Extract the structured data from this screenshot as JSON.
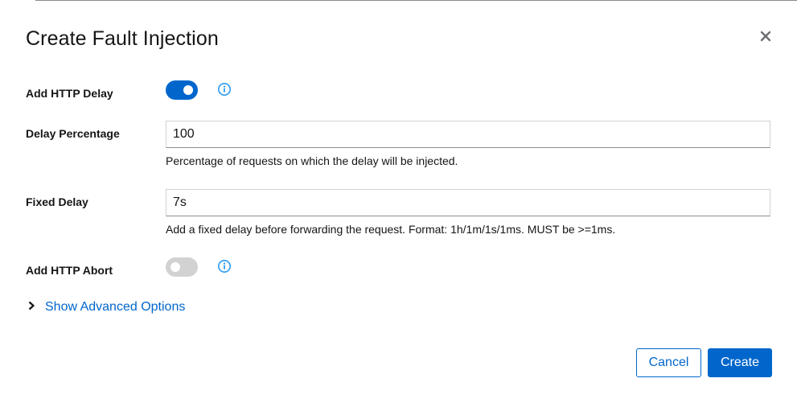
{
  "dialog": {
    "title": "Create Fault Injection",
    "close_icon": "close-icon"
  },
  "fields": {
    "http_delay": {
      "label": "Add HTTP Delay",
      "enabled": true,
      "info_icon": "info-icon"
    },
    "delay_percentage": {
      "label": "Delay Percentage",
      "value": "100",
      "help": "Percentage of requests on which the delay will be injected."
    },
    "fixed_delay": {
      "label": "Fixed Delay",
      "value": "7s",
      "help": "Add a fixed delay before forwarding the request. Format: 1h/1m/1s/1ms. MUST be >=1ms."
    },
    "http_abort": {
      "label": "Add HTTP Abort",
      "enabled": false,
      "info_icon": "info-icon"
    }
  },
  "advanced": {
    "label": "Show Advanced Options",
    "icon": "chevron-right-icon"
  },
  "actions": {
    "cancel_label": "Cancel",
    "create_label": "Create"
  },
  "colors": {
    "primary": "#0066cc",
    "toggle_off": "#d2d2d2",
    "text": "#151515"
  }
}
